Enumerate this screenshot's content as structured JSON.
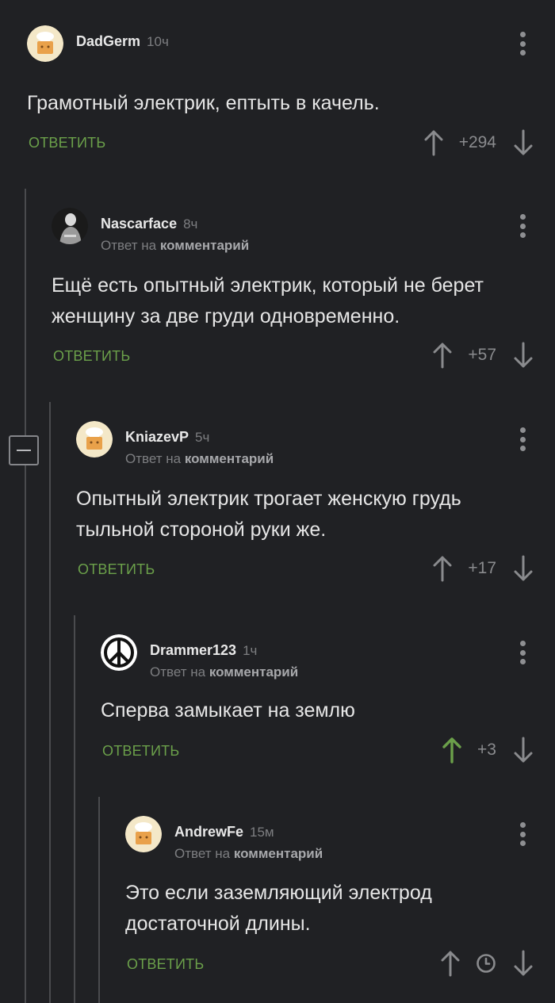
{
  "labels": {
    "reply_prefix": "Ответ на",
    "reply_link": "комментарий",
    "reply_button": "ОТВЕТИТЬ"
  },
  "colors": {
    "background": "#202124",
    "accent_green": "#6ba04a",
    "muted_text": "#7d7e81",
    "thread_line": "#4a4b4e"
  },
  "comments": [
    {
      "author": "DadGerm",
      "time": "10ч",
      "is_reply": false,
      "text": "Грамотный электрик, ептыть в качель.",
      "score": "+294",
      "upvoted": false,
      "avatar_icon": "chef-avatar-icon"
    },
    {
      "author": "Nascarface",
      "time": "8ч",
      "is_reply": true,
      "text": "Ещё есть опытный электрик, который не берет женщину за две груди одновременно.",
      "score": "+57",
      "upvoted": false,
      "avatar_icon": "dark-figure-avatar-icon"
    },
    {
      "author": "KniazevP",
      "time": "5ч",
      "is_reply": true,
      "text": "Опытный электрик трогает женскую грудь тыльной стороной руки же.",
      "score": "+17",
      "upvoted": false,
      "avatar_icon": "chef-avatar-icon"
    },
    {
      "author": "Drammer123",
      "time": "1ч",
      "is_reply": true,
      "text": "Сперва замыкает на землю",
      "score": "+3",
      "upvoted": true,
      "avatar_icon": "peace-sign-avatar-icon"
    },
    {
      "author": "AndrewFe",
      "time": "15м",
      "is_reply": true,
      "text": "Это если заземляющий электрод достаточной длины.",
      "score": "",
      "score_icon": "clock-icon",
      "upvoted": false,
      "avatar_icon": "chef-avatar-icon"
    }
  ]
}
